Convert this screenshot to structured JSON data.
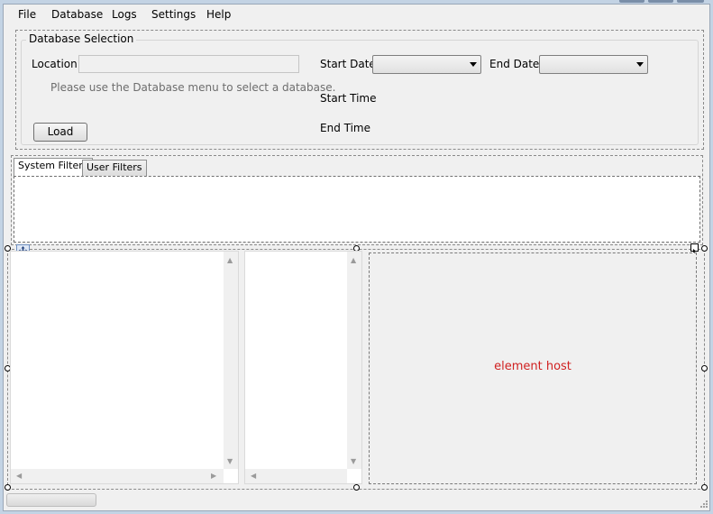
{
  "menu": {
    "items": [
      "File",
      "Database",
      "Logs",
      "Settings",
      "Help"
    ]
  },
  "database_selection": {
    "title": "Database Selection",
    "location_label": "Location",
    "location_value": "",
    "hint": "Please use the Database menu to select a database.",
    "load_label": "Load",
    "start_date_label": "Start Date",
    "end_date_label": "End Date",
    "start_date_value": "",
    "end_date_value": "",
    "start_time_label": "Start Time",
    "end_time_label": "End Time"
  },
  "filters": {
    "tabs": [
      "System Filters",
      "User Filters"
    ],
    "active_tab": "System Filters"
  },
  "element_host": {
    "label": "element host",
    "label_color": "#d02020"
  },
  "colors": {
    "form_background": "#f0f0f0",
    "window_frame": "#c3d3e4"
  },
  "icons": {
    "move": "move-icon",
    "size_grip": "resize-grip-icon"
  }
}
